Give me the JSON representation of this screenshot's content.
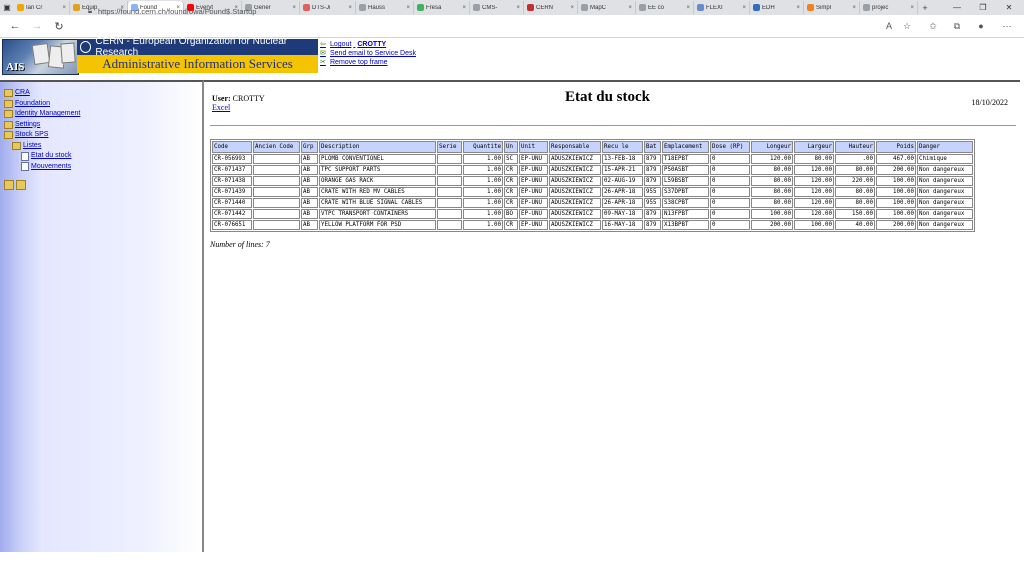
{
  "browser": {
    "tabs": [
      {
        "title": "Ian Cr",
        "color": "#f4a400"
      },
      {
        "title": "Equip",
        "color": "#e0a020"
      },
      {
        "title": "Found",
        "color": "#8ab4f8",
        "active": true
      },
      {
        "title": "Everyt",
        "color": "#ff0000"
      },
      {
        "title": "Gener",
        "color": "#9aa0a6"
      },
      {
        "title": "DTS-Ji",
        "color": "#e06060"
      },
      {
        "title": "Hauss",
        "color": "#9aa0a6"
      },
      {
        "title": "Fresa",
        "color": "#40b060"
      },
      {
        "title": "CMS-",
        "color": "#9aa0a6"
      },
      {
        "title": "CERN",
        "color": "#c03030"
      },
      {
        "title": "MapC",
        "color": "#9aa0a6"
      },
      {
        "title": "EE co",
        "color": "#9aa0a6"
      },
      {
        "title": "FLEXI",
        "color": "#6a8ad0"
      },
      {
        "title": "EDH",
        "color": "#3070c0"
      },
      {
        "title": "Simpl",
        "color": "#f08020"
      },
      {
        "title": "projec",
        "color": "#9aa0a6"
      }
    ],
    "url": "https://found.cern.ch/found/owa/Found$.Startup"
  },
  "banner": {
    "org": "CERN - European Organization for Nuclear Research",
    "service": "Administrative Information Services",
    "logo_text": "AIS",
    "links": {
      "logout_prefix": "Logout",
      "logout_user": "CROTTY",
      "email": "Send email to Service Desk",
      "remove": "Remove top frame"
    }
  },
  "tree": {
    "cra": "CRA",
    "foundation": "Foundation",
    "identity": "Identity Management",
    "settings": "Settings",
    "stock": "Stock SPS",
    "listes": "Listes",
    "etat": "Etat du stock",
    "mouvements": "Mouvements"
  },
  "main": {
    "user_label": "User:",
    "user": "CROTTY",
    "excel": "Excel",
    "title": "Etat du stock",
    "date": "18/10/2022",
    "lines_text": "Number of lines: 7"
  },
  "table": {
    "headers": [
      "Code",
      "Ancien Code",
      "Grp",
      "Description",
      "Serie",
      "Quantite",
      "Un",
      "Unit",
      "Responsable",
      "Recu le",
      "Bat",
      "Emplacement",
      "Dose (RP)",
      "Longeur",
      "Largeur",
      "Hauteur",
      "Poids",
      "Danger"
    ],
    "rows": [
      [
        "CR-056993",
        "",
        "AB",
        "PLOMB CONVENTIONEL",
        "",
        "1.00",
        "SC",
        "EP-UNU",
        "ADUSZKIEWICZ",
        "13-FEB-18",
        "879",
        "T18EPBT",
        "0",
        "120.00",
        "80.00",
        ".00",
        "467.00",
        "Chimique"
      ],
      [
        "CR-071437",
        "",
        "AB",
        "TPC SUPPORT PARTS",
        "",
        "1.00",
        "CR",
        "EP-UNU",
        "ADUSZKIEWICZ",
        "15-APR-21",
        "879",
        "P50ASBT",
        "0",
        "80.00",
        "120.00",
        "80.00",
        "200.00",
        "Non dangereux"
      ],
      [
        "CR-071438",
        "",
        "AB",
        "ORANGE GAS RACK",
        "",
        "1.00",
        "CR",
        "EP-UNU",
        "ADUSZKIEWICZ",
        "02-AUG-19",
        "879",
        "L59BSBT",
        "0",
        "80.00",
        "120.00",
        "220.00",
        "100.00",
        "Non dangereux"
      ],
      [
        "CR-071439",
        "",
        "AB",
        "CRATE WITH RED MV CABLES",
        "",
        "1.00",
        "CR",
        "EP-UNU",
        "ADUSZKIEWICZ",
        "26-APR-18",
        "955",
        "S37DPBT",
        "0",
        "80.00",
        "120.00",
        "80.00",
        "100.00",
        "Non dangereux"
      ],
      [
        "CR-071440",
        "",
        "AB",
        "CRATE WITH BLUE SIGNAL CABLES",
        "",
        "1.00",
        "CR",
        "EP-UNU",
        "ADUSZKIEWICZ",
        "26-APR-18",
        "955",
        "S38CPBT",
        "0",
        "80.00",
        "120.00",
        "80.00",
        "100.00",
        "Non dangereux"
      ],
      [
        "CR-071442",
        "",
        "AB",
        "VTPC TRANSPORT CONTAINERS",
        "",
        "1.00",
        "BO",
        "EP-UNU",
        "ADUSZKIEWICZ",
        "09-MAY-18",
        "879",
        "N13FPBT",
        "0",
        "100.00",
        "120.00",
        "150.00",
        "100.00",
        "Non dangereux"
      ],
      [
        "CR-076651",
        "",
        "AB",
        "YELLOW PLATFORM FOR PSD",
        "",
        "1.00",
        "CR",
        "EP-UNU",
        "ADUSZKIEWICZ",
        "16-MAY-18",
        "879",
        "X13BPBT",
        "0",
        "200.00",
        "100.00",
        "40.00",
        "200.00",
        "Non dangereux"
      ]
    ]
  }
}
